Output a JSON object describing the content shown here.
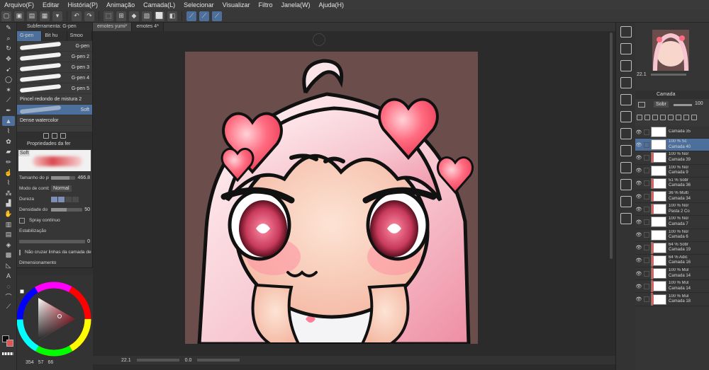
{
  "menu": [
    "Arquivo(F)",
    "Editar",
    "História(P)",
    "Animação",
    "Camada(L)",
    "Selecionar",
    "Visualizar",
    "Filtro",
    "Janela(W)",
    "Ajuda(H)"
  ],
  "subtool": {
    "header": "Subferramenta: G-pen",
    "tabs": [
      "G-pen",
      "Bit hu",
      "Smoo"
    ],
    "brushes": [
      {
        "name": "G-pen"
      },
      {
        "name": "G-pen 2"
      },
      {
        "name": "G-pen 3"
      },
      {
        "name": "G-pen 4"
      },
      {
        "name": "G-pen 5"
      },
      {
        "name": "Pincel redondo de mistura 2"
      },
      {
        "name": "Soft"
      },
      {
        "name": "Dense watercolor"
      }
    ]
  },
  "properties": {
    "header": "Propriedades da fer",
    "preview_label": "Soft",
    "brush_size_label": "Tamanho do pincel",
    "brush_size_value": "466.8",
    "brush_size_fraction": 0.75,
    "blend_mode_label": "Modo de combinação",
    "blend_mode_value": "Normal",
    "hardness_label": "Dureza",
    "hardness_level": 2,
    "density_label": "Densidade do pincel",
    "density_value": "50",
    "density_fraction": 0.5,
    "spray_label": "Spray contínuo",
    "stabilization_label": "Estabilização",
    "stabilization_value": "0",
    "no_cross_label": "Não cruzar linhas da camada de",
    "dimension_label": "Dimensionamento"
  },
  "color": {
    "main": "#0c0c0c",
    "sub": "#e05454",
    "picked": "#d92b3c",
    "readout": [
      "354",
      "57",
      "66"
    ]
  },
  "document_tabs": [
    "emotes yumi*",
    "emotes 4*"
  ],
  "status": {
    "zoom": "22.1",
    "angle": "0.0"
  },
  "navigator": {
    "zoom": "22.1"
  },
  "layer_panel": {
    "title": "Camada",
    "blend_mode": "Sobr",
    "opacity": "100"
  },
  "layers": [
    {
      "mode": "",
      "name": "Camada 35"
    },
    {
      "mode": "100 % Sc",
      "name": "Camada 40",
      "selected": true
    },
    {
      "mode": "100 % Nor",
      "name": "Camada 39"
    },
    {
      "mode": "100 % Nor",
      "name": "Camada 9"
    },
    {
      "mode": "51 % Sobr",
      "name": "Camada 36"
    },
    {
      "mode": "36 % Multi",
      "name": "Camada 34"
    },
    {
      "mode": "100 % Nor",
      "name": "Pasta 2 Co"
    },
    {
      "mode": "100 % Nor",
      "name": "Camada 7"
    },
    {
      "mode": "100 % Nor",
      "name": "Camada 6"
    },
    {
      "mode": "64 % Sobr",
      "name": "Camada 19"
    },
    {
      "mode": "64 % Adic",
      "name": "Camada 16"
    },
    {
      "mode": "100 % Mul",
      "name": "Camada 14"
    },
    {
      "mode": "100 % Mul",
      "name": "Camada 14"
    },
    {
      "mode": "100 % Mul",
      "name": "Camada 18"
    }
  ]
}
